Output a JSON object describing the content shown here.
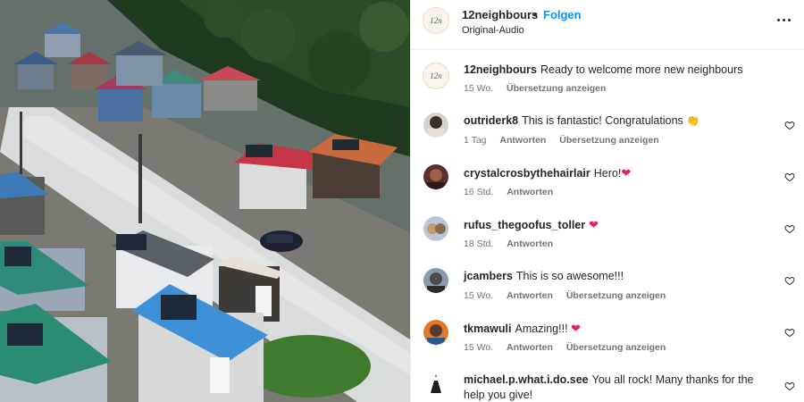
{
  "post": {
    "username": "12neighbours",
    "follow_label": "Folgen",
    "separator": "•",
    "audio": "Original-Audio",
    "avatar_text": "12n"
  },
  "caption": {
    "username": "12neighbours",
    "text": "Ready to welcome more new neighbours",
    "time": "15 Wo.",
    "translate": "Übersetzung anzeigen"
  },
  "comments": [
    {
      "username": "outriderk8",
      "text": "This is fantastic! Congratulations",
      "emoji": "👏",
      "time": "1 Tag",
      "reply": "Antworten",
      "translate": "Übersetzung anzeigen"
    },
    {
      "username": "crystalcrosbythehairlair",
      "text": "Hero!",
      "emoji": "❤",
      "time": "16 Std.",
      "reply": "Antworten"
    },
    {
      "username": "rufus_thegoofus_toller",
      "text": "",
      "emoji": "❤",
      "time": "18 Std.",
      "reply": "Antworten"
    },
    {
      "username": "jcambers",
      "text": "This is so awesome!!!",
      "time": "15 Wo.",
      "reply": "Antworten",
      "translate": "Übersetzung anzeigen"
    },
    {
      "username": "tkmawuli",
      "text": "Amazing!!!",
      "emoji": "❤",
      "time": "15 Wo.",
      "reply": "Antworten",
      "translate": "Übersetzung anzeigen"
    },
    {
      "username": "michael.p.what.i.do.see",
      "text": "You all rock! Many thanks for the help you give!"
    }
  ],
  "colors": {
    "accent": "#0095f6",
    "meta": "#737373",
    "heart": "#e0245e"
  }
}
